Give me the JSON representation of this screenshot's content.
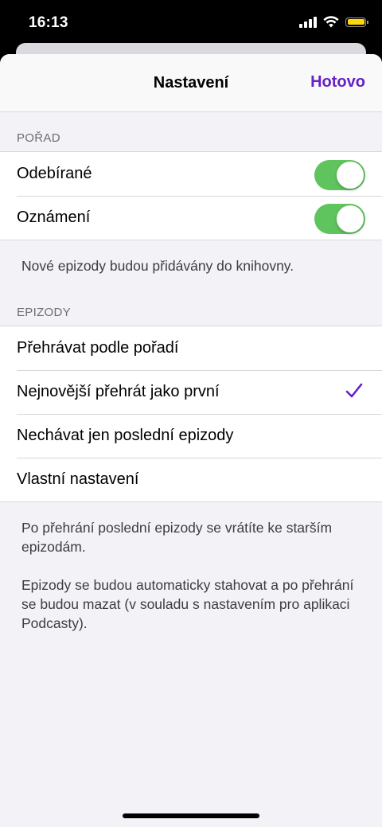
{
  "status_bar": {
    "time": "16:13",
    "icons": [
      "signal-icon",
      "wifi-icon",
      "battery-icon"
    ],
    "battery_color": "#ffd60a"
  },
  "nav": {
    "title": "Nastavení",
    "done_label": "Hotovo",
    "accent_color": "#6321c6"
  },
  "section_show": {
    "header": "POŘAD",
    "rows": [
      {
        "label": "Odebírané",
        "toggle_on": true
      },
      {
        "label": "Oznámení",
        "toggle_on": true
      }
    ],
    "footer": "Nové epizody budou přidávány do knihovny."
  },
  "section_episodes": {
    "header": "EPIZODY",
    "rows": [
      {
        "label": "Přehrávat podle pořadí",
        "selected": false
      },
      {
        "label": "Nejnovější přehrát jako první",
        "selected": true
      },
      {
        "label": "Nechávat jen poslední epizody",
        "selected": false
      },
      {
        "label": "Vlastní nastavení",
        "selected": false
      }
    ],
    "footer_1": "Po přehrání poslední epizody se vrátíte ke starším epizodám.",
    "footer_2": "Epizody se budou automaticky stahovat a po přehrání se budou mazat (v souladu s nastavením pro aplikaci Podcasty)."
  },
  "toggle_color": "#5fc45d"
}
